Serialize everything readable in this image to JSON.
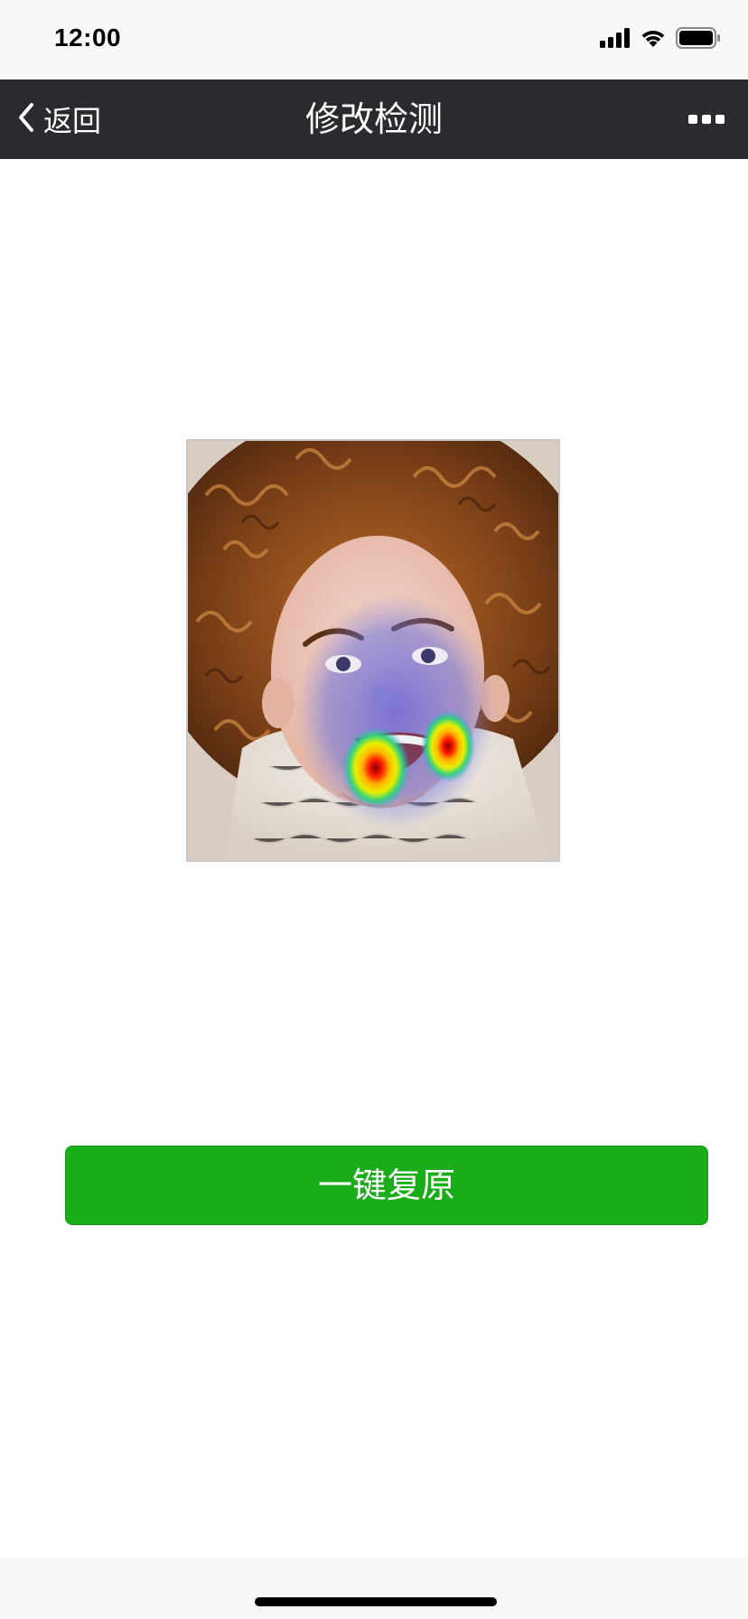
{
  "status_bar": {
    "time": "12:00",
    "icons": [
      "signal-icon",
      "wifi-icon",
      "battery-icon"
    ]
  },
  "nav": {
    "back_label": "返回",
    "title": "修改检测",
    "more_icon": "more-icon"
  },
  "main": {
    "restore_button_label": "一键复原"
  },
  "colors": {
    "nav_background": "#2b2b2f",
    "button_green": "#1aad19",
    "status_background": "#f7f7f7"
  }
}
